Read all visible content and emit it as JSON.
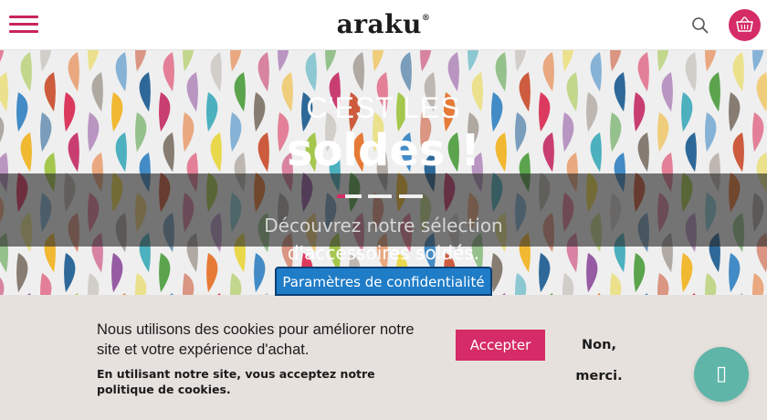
{
  "header": {
    "logo_text": "araku",
    "logo_mark": "®",
    "menu_icon": "hamburger-icon",
    "search_icon": "search-icon",
    "cart_icon": "basket-icon"
  },
  "hero": {
    "line1": "C'EST LES",
    "line2": "soldes !",
    "description_line1": "Découvrez notre sélection",
    "description_line2": "d'accessoires soldés.",
    "slides_count": 3
  },
  "privacy": {
    "label": "Paramètres de confidentialité"
  },
  "cookie": {
    "message": "Nous utilisons des cookies pour améliorer notre site et votre expérience d'achat.",
    "notice": "En utilisant notre site, vous acceptez notre politique de cookies.",
    "accept_label": "Accepter",
    "decline_label": "Non, merci."
  },
  "chat": {
    "icon": "chat-icon",
    "glyph": "▯"
  },
  "colors": {
    "accent": "#d52b66",
    "privacy_button": "#1f7cc7",
    "chat_button": "#5fb5a8",
    "cookie_bg": "#e7e1dd"
  }
}
